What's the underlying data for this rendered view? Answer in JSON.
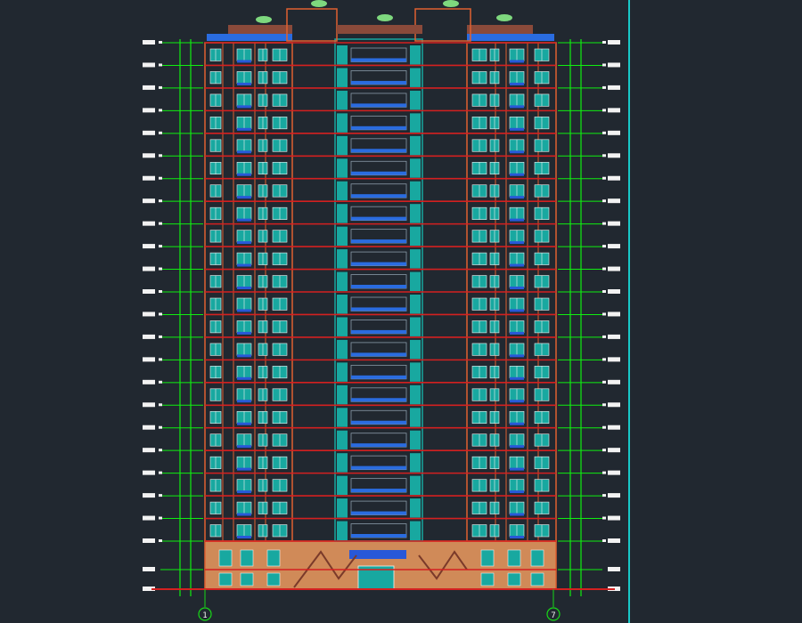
{
  "drawing": {
    "background": "#212830",
    "floor_count": 22,
    "podium_floor_count": 2,
    "axis_labels": [
      "1",
      "7"
    ],
    "colors": {
      "floor_line": "#d42020",
      "wall_outline": "#e06030",
      "window_teal": "#18a8a0",
      "window_blue": "#2858d8",
      "balcony_blue": "#2a6ce0",
      "dimension_green": "#10ee10",
      "label_white": "#f2f2f2",
      "podium_fill": "#d08a58",
      "roof_brown": "#8a4a3a",
      "plant_green": "#7ed87e",
      "viewport_border": "#18c8c8",
      "axis_circle": "#18d818"
    }
  }
}
